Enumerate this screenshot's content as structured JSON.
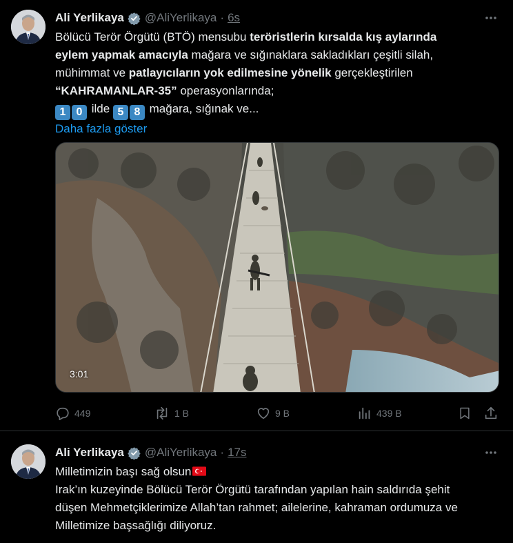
{
  "tweets": [
    {
      "author": {
        "name": "Ali Yerlikaya",
        "handle": "@AliYerlikaya",
        "time": "6s"
      },
      "text": {
        "l1_a": "Bölücü Terör Örgütü (BTÖ) mensubu ",
        "l1_b": "teröristlerin kırsalda kış aylarında",
        "l2_a": "eylem yapmak amacıyla",
        "l2_b": " mağara ve sığınaklara sakladıkları çeşitli silah,",
        "l3_a": "mühimmat ve ",
        "l3_b": "patlayıcıların yok edilmesine yönelik",
        "l3_c": " gerçekleştirilen",
        "l4_a": "“KAHRAMANLAR-35”",
        "l4_b": " operasyonlarında;",
        "l5_d1": "1",
        "l5_d2": "0",
        "l5_a": " ilde ",
        "l5_d3": "5",
        "l5_d4": "8",
        "l5_b": " mağara, sığınak ve...",
        "show_more": "Daha fazla göster"
      },
      "media": {
        "duration": "3:01"
      },
      "stats": {
        "replies": "449",
        "reposts": "1 B",
        "likes": "9 B",
        "views": "439 B"
      }
    },
    {
      "author": {
        "name": "Ali Yerlikaya",
        "handle": "@AliYerlikaya",
        "time": "17s"
      },
      "text": {
        "l1": "Milletimizin başı sağ olsun",
        "l2": "Irak’ın kuzeyinde Bölücü Terör Örgütü tarafından yapılan hain saldırıda şehit",
        "l3": "düşen Mehmetçiklerimize Allah’tan rahmet; ailelerine, kahraman ordumuza ve",
        "l4": "Milletimize başsağlığı diliyoruz."
      }
    }
  ],
  "colors": {
    "background": "#000000",
    "text": "#e7e9ea",
    "muted": "#71767b",
    "link": "#1d9bf0",
    "verified": "#829aab"
  },
  "icons": [
    "more-icon",
    "verified-badge-icon",
    "reply-icon",
    "repost-icon",
    "like-icon",
    "views-icon",
    "bookmark-icon",
    "share-icon",
    "turkey-flag-icon"
  ]
}
